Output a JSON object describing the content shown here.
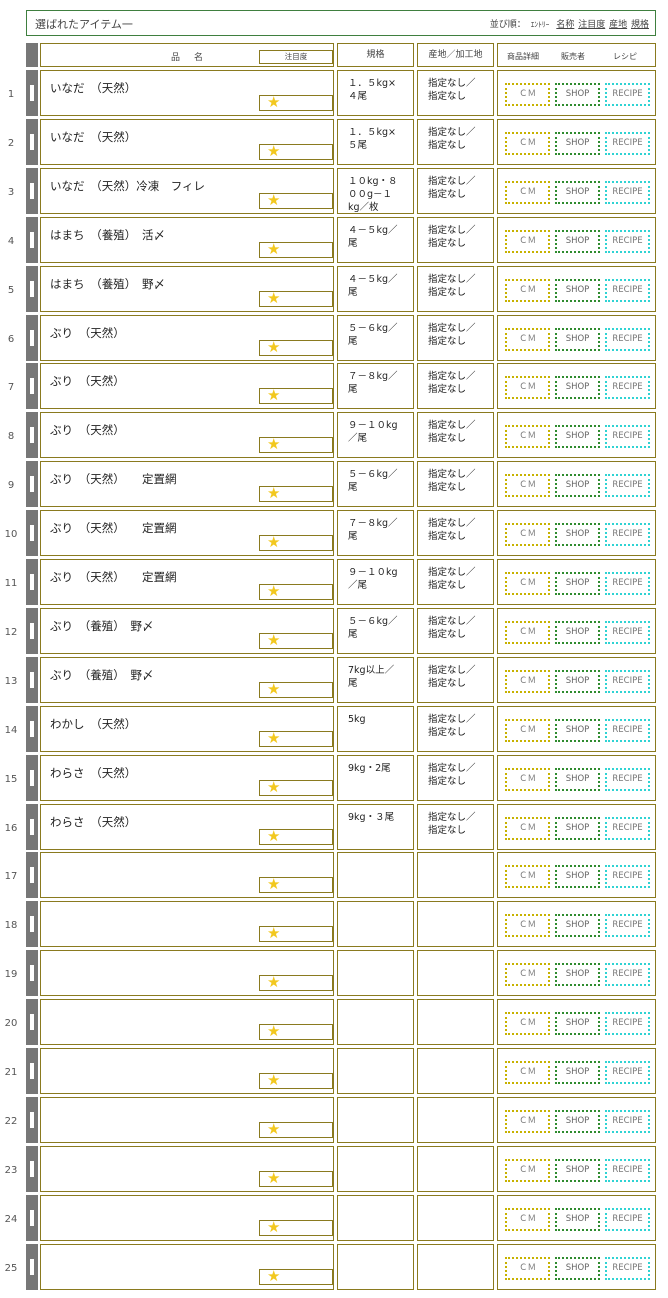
{
  "header": {
    "title": "選ばれたアイテム一",
    "sort_label": "並び順：",
    "sort_entry": "ｴﾝﾄﾘｰ",
    "sort_options": [
      "名称",
      "注目度",
      "産地",
      "規格"
    ]
  },
  "columns": {
    "name": "品名",
    "attention": "注目度",
    "spec": "規格",
    "origin": "産地／加工地",
    "detail": "商品詳細",
    "seller": "販売者",
    "recipe": "レシピ"
  },
  "buttons": {
    "cm": "ＣＭ",
    "shop": "SHOP",
    "recipe": "RECIPE"
  },
  "rows": [
    {
      "num": "1",
      "name": "いなだ　（天然）",
      "spec": "１．５kg×\n４尾",
      "origin": "指定なし／\n指定なし"
    },
    {
      "num": "2",
      "name": "いなだ　（天然）",
      "spec": "１．５kg×\n５尾",
      "origin": "指定なし／\n指定なし"
    },
    {
      "num": "3",
      "name": "いなだ　（天然）冷凍　フィレ",
      "spec": "１０kg・８\n００g－１\nkg／枚",
      "origin": "指定なし／\n指定なし"
    },
    {
      "num": "4",
      "name": "はまち　（養殖）　活〆",
      "spec": "４－５kg／\n尾",
      "origin": "指定なし／\n指定なし"
    },
    {
      "num": "5",
      "name": "はまち　（養殖）　野〆",
      "spec": "４－５kg／\n尾",
      "origin": "指定なし／\n指定なし"
    },
    {
      "num": "6",
      "name": "ぶり　（天然）",
      "spec": "５－６kg／\n尾",
      "origin": "指定なし／\n指定なし"
    },
    {
      "num": "7",
      "name": "ぶり　（天然）",
      "spec": "７－８kg／\n尾",
      "origin": "指定なし／\n指定なし"
    },
    {
      "num": "8",
      "name": "ぶり　（天然）",
      "spec": "９－１０kg\n／尾",
      "origin": "指定なし／\n指定なし"
    },
    {
      "num": "9",
      "name": "ぶり　（天然）　　定置網",
      "spec": "５－６kg／\n尾",
      "origin": "指定なし／\n指定なし"
    },
    {
      "num": "10",
      "name": "ぶり　（天然）　　定置網",
      "spec": "７－８kg／\n尾",
      "origin": "指定なし／\n指定なし"
    },
    {
      "num": "11",
      "name": "ぶり　（天然）　　定置網",
      "spec": "９－１０kg\n／尾",
      "origin": "指定なし／\n指定なし"
    },
    {
      "num": "12",
      "name": "ぶり　（養殖）　野〆",
      "spec": "５－６kg／\n尾",
      "origin": "指定なし／\n指定なし"
    },
    {
      "num": "13",
      "name": "ぶり　（養殖）　野〆",
      "spec": "7kg以上／\n尾",
      "origin": "指定なし／\n指定なし"
    },
    {
      "num": "14",
      "name": "わかし　（天然）",
      "spec": "5kg",
      "origin": "指定なし／\n指定なし"
    },
    {
      "num": "15",
      "name": "わらさ　（天然）",
      "spec": "9kg・2尾",
      "origin": "指定なし／\n指定なし"
    },
    {
      "num": "16",
      "name": "わらさ　（天然）",
      "spec": "9kg・３尾",
      "origin": "指定なし／\n指定なし"
    },
    {
      "num": "17",
      "name": "",
      "spec": "",
      "origin": ""
    },
    {
      "num": "18",
      "name": "",
      "spec": "",
      "origin": ""
    },
    {
      "num": "19",
      "name": "",
      "spec": "",
      "origin": ""
    },
    {
      "num": "20",
      "name": "",
      "spec": "",
      "origin": ""
    },
    {
      "num": "21",
      "name": "",
      "spec": "",
      "origin": ""
    },
    {
      "num": "22",
      "name": "",
      "spec": "",
      "origin": ""
    },
    {
      "num": "23",
      "name": "",
      "spec": "",
      "origin": ""
    },
    {
      "num": "24",
      "name": "",
      "spec": "",
      "origin": ""
    },
    {
      "num": "25",
      "name": "",
      "spec": "",
      "origin": ""
    }
  ]
}
